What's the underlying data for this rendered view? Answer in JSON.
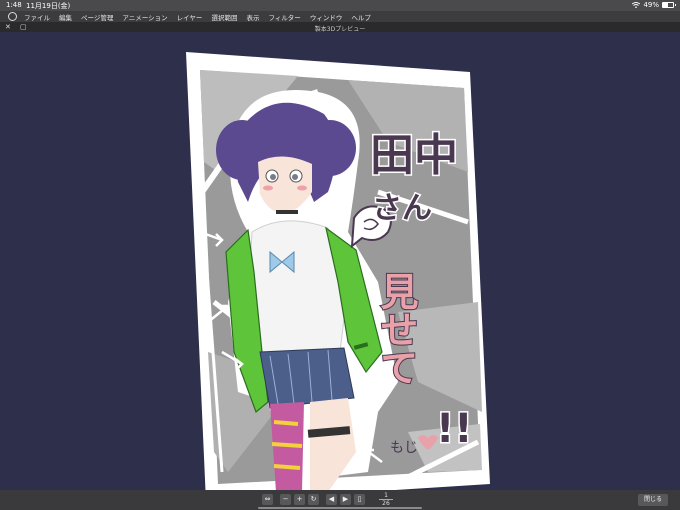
{
  "status_bar": {
    "time": "1:48",
    "date": "11月19日(金)",
    "battery_text": "49%",
    "battery_level": 0.49
  },
  "menu": {
    "items": [
      "ファイル",
      "編集",
      "ページ管理",
      "アニメーション",
      "レイヤー",
      "選択範囲",
      "表示",
      "フィルター",
      "ウィンドウ",
      "ヘルプ"
    ]
  },
  "window": {
    "title": "製本3Dプレビュー",
    "close_glyph": "✕",
    "restore_glyph": "▢"
  },
  "artwork": {
    "title_lines": [
      "田中",
      "さん",
      "見せて",
      "!!"
    ],
    "signature": "もじ"
  },
  "toolbar": {
    "current_page": "1",
    "total_pages": "26",
    "close_label": "閉じる"
  },
  "colors": {
    "background": "#2e2f4b",
    "accent_green": "#5ec43a",
    "hair_purple": "#5b4a8f",
    "title_purple": "#4a3850",
    "title_pink": "#e9a1a9"
  }
}
